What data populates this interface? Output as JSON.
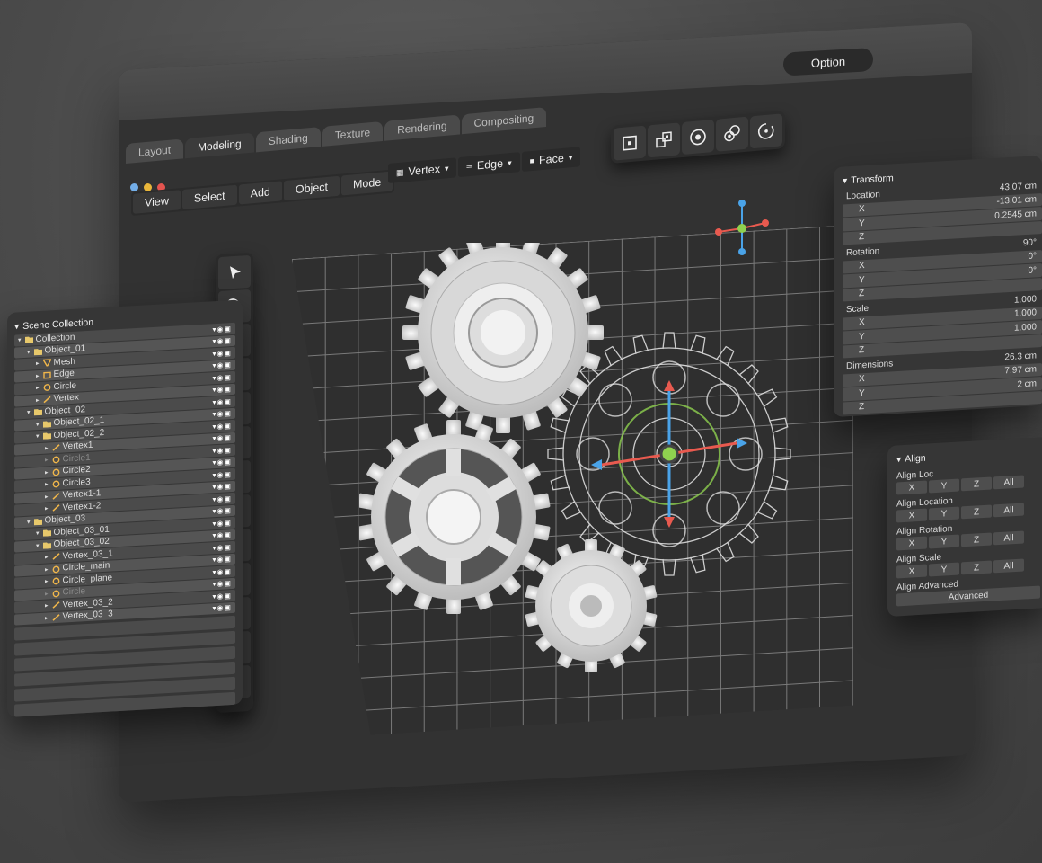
{
  "window": {
    "traffic_lights": {
      "close": "#e4544f",
      "minimize": "#e9b63a",
      "maximize": "#73aee8"
    },
    "option_label": "Option"
  },
  "tabs": [
    {
      "label": "Layout",
      "active": false
    },
    {
      "label": "Modeling",
      "active": true
    },
    {
      "label": "Shading",
      "active": false
    },
    {
      "label": "Texture",
      "active": false
    },
    {
      "label": "Rendering",
      "active": false
    },
    {
      "label": "Compositing",
      "active": false
    }
  ],
  "menu": [
    "View",
    "Select",
    "Add",
    "Object",
    "Mode"
  ],
  "select_modes": [
    {
      "label": "Vertex",
      "icon": "grid-icon"
    },
    {
      "label": "Edge",
      "icon": "edge-icon"
    },
    {
      "label": "Face",
      "icon": "face-icon"
    }
  ],
  "snap_tools": [
    "snap-center-icon",
    "snap-multi-icon",
    "snap-target-icon",
    "snap-link-icon",
    "snap-rotate-icon"
  ],
  "tools": [
    "select-arrow-icon",
    "zoom-icon",
    "move-icon",
    "rotate-icon",
    "scale-icon",
    "transform-icon",
    "extrude-icon",
    "knife-icon",
    "bevel-icon",
    "loop-cut-icon",
    "spin-icon",
    "snap-center-icon",
    "snap-multi-icon"
  ],
  "scene": {
    "title": "Scene Collection",
    "rows": [
      {
        "indent": 0,
        "label": "Collection",
        "icon": "folder",
        "dim": false
      },
      {
        "indent": 1,
        "label": "Object_01",
        "icon": "folder",
        "dim": false
      },
      {
        "indent": 2,
        "label": "Mesh",
        "icon": "mesh",
        "dim": false
      },
      {
        "indent": 2,
        "label": "Edge",
        "icon": "square",
        "dim": false
      },
      {
        "indent": 2,
        "label": "Circle",
        "icon": "circle",
        "dim": false
      },
      {
        "indent": 2,
        "label": "Vertex",
        "icon": "vertex",
        "dim": false
      },
      {
        "indent": 1,
        "label": "Object_02",
        "icon": "folder",
        "dim": false
      },
      {
        "indent": 2,
        "label": "Object_02_1",
        "icon": "folder",
        "dim": false
      },
      {
        "indent": 2,
        "label": "Object_02_2",
        "icon": "folder",
        "dim": false
      },
      {
        "indent": 3,
        "label": "Vertex1",
        "icon": "vertex",
        "dim": false
      },
      {
        "indent": 3,
        "label": "Circle1",
        "icon": "circle",
        "dim": true
      },
      {
        "indent": 3,
        "label": "Circle2",
        "icon": "circle",
        "dim": false
      },
      {
        "indent": 3,
        "label": "Circle3",
        "icon": "circle",
        "dim": false
      },
      {
        "indent": 3,
        "label": "Vertex1-1",
        "icon": "vertex",
        "dim": false
      },
      {
        "indent": 3,
        "label": "Vertex1-2",
        "icon": "vertex",
        "dim": false
      },
      {
        "indent": 1,
        "label": "Object_03",
        "icon": "folder",
        "dim": false
      },
      {
        "indent": 2,
        "label": "Object_03_01",
        "icon": "folder",
        "dim": false
      },
      {
        "indent": 2,
        "label": "Object_03_02",
        "icon": "folder",
        "dim": false
      },
      {
        "indent": 3,
        "label": "Vertex_03_1",
        "icon": "vertex",
        "dim": false
      },
      {
        "indent": 3,
        "label": "Circle_main",
        "icon": "circle",
        "dim": false
      },
      {
        "indent": 3,
        "label": "Circle_plane",
        "icon": "circle",
        "dim": false
      },
      {
        "indent": 3,
        "label": "Circle",
        "icon": "circle",
        "dim": true
      },
      {
        "indent": 3,
        "label": "Vertex_03_2",
        "icon": "vertex",
        "dim": false
      },
      {
        "indent": 3,
        "label": "Vertex_03_3",
        "icon": "vertex",
        "dim": false
      }
    ]
  },
  "transform": {
    "title": "Transform",
    "rows": [
      {
        "type": "head",
        "label": "Location",
        "value": "43.07 cm"
      },
      {
        "type": "field",
        "label": "X",
        "value": "-13.01 cm"
      },
      {
        "type": "field",
        "label": "Y",
        "value": "0.2545 cm"
      },
      {
        "type": "field",
        "label": "Z",
        "value": ""
      },
      {
        "type": "head",
        "label": "Rotation",
        "value": "90°"
      },
      {
        "type": "field",
        "label": "X",
        "value": "0°"
      },
      {
        "type": "field",
        "label": "Y",
        "value": "0°"
      },
      {
        "type": "field",
        "label": "Z",
        "value": ""
      },
      {
        "type": "head",
        "label": "Scale",
        "value": "1.000"
      },
      {
        "type": "field",
        "label": "X",
        "value": "1.000"
      },
      {
        "type": "field",
        "label": "Y",
        "value": "1.000"
      },
      {
        "type": "field",
        "label": "Z",
        "value": ""
      },
      {
        "type": "head",
        "label": "Dimensions",
        "value": "26.3 cm"
      },
      {
        "type": "field",
        "label": "X",
        "value": "7.97 cm"
      },
      {
        "type": "field",
        "label": "Y",
        "value": "2 cm"
      },
      {
        "type": "field",
        "label": "Z",
        "value": ""
      }
    ]
  },
  "align": {
    "title": "Align",
    "groups": [
      {
        "label": "Align Loc",
        "buttons": [
          "X",
          "Y",
          "Z",
          "All"
        ]
      },
      {
        "label": "Align Location",
        "buttons": [
          "X",
          "Y",
          "Z",
          "All"
        ]
      },
      {
        "label": "Align Rotation",
        "buttons": [
          "X",
          "Y",
          "Z",
          "All"
        ]
      },
      {
        "label": "Align Scale",
        "buttons": [
          "X",
          "Y",
          "Z",
          "All"
        ]
      },
      {
        "label": "Align Advanced",
        "buttons": [
          "Advanced"
        ]
      }
    ]
  }
}
